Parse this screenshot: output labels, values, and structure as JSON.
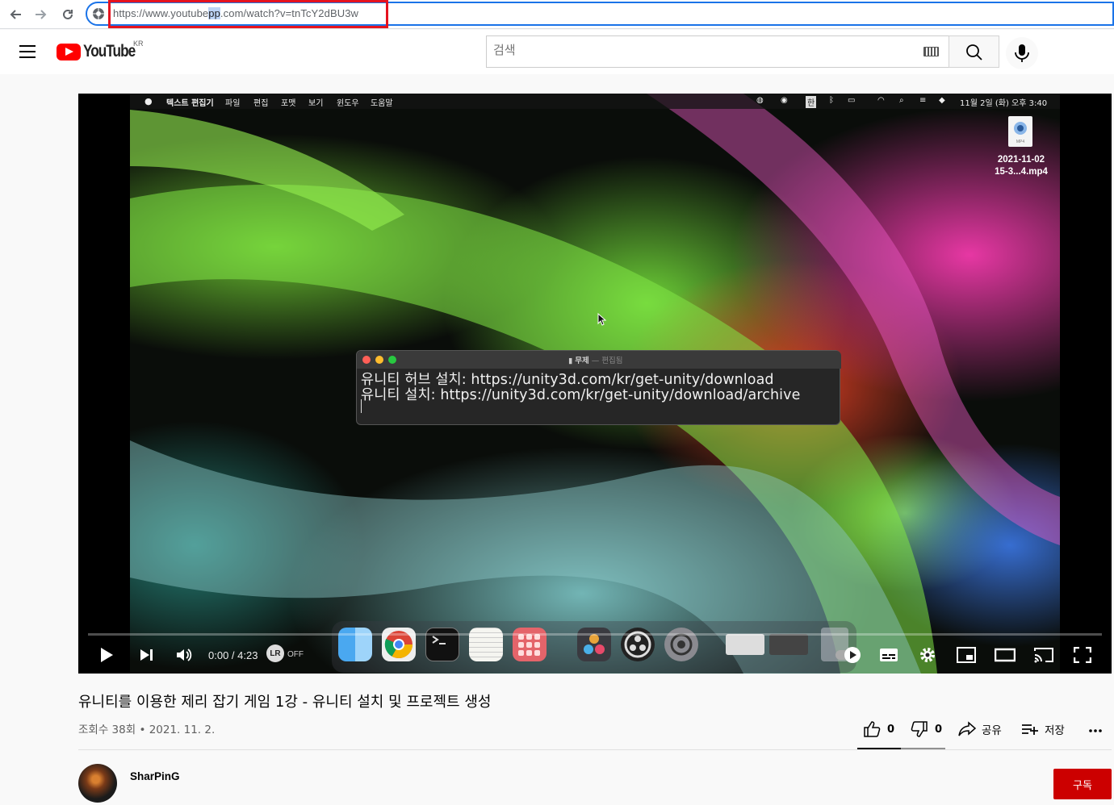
{
  "browser": {
    "url_prefix": "https://www.youtube",
    "url_highlight": "pp",
    "url_suffix": ".com/watch?v=tnTcY2dBU3w"
  },
  "header": {
    "logo_text": "YouTube",
    "region": "KR",
    "search_placeholder": "검색"
  },
  "video_frame": {
    "menubar": {
      "app": "텍스트 편집기",
      "items": [
        "파일",
        "편집",
        "포맷",
        "보기",
        "윈도우",
        "도움말"
      ],
      "ime": "한",
      "clock": "11월 2일 (화) 오후 3:40"
    },
    "desktop_file": {
      "badge": "MP4",
      "line1": "2021-11-02",
      "line2": "15-3...4.mp4"
    },
    "editor": {
      "title": "무제",
      "status": "— 편집됨",
      "lines": [
        "유니티 허브 설치: https://unity3d.com/kr/get-unity/download",
        "유니티 설치: https://unity3d.com/kr/get-unity/download/archive"
      ]
    }
  },
  "player": {
    "time": "0:00 / 4:23",
    "lr_badge": "LR",
    "lr_state": "OFF",
    "progress": 0
  },
  "video": {
    "title": "유니티를 이용한 제리 잡기 게임 1강 - 유니티 설치 및 프로젝트 생성",
    "meta": "조회수 38회 • 2021. 11. 2."
  },
  "actions": {
    "like_count": "0",
    "dislike_count": "0",
    "share_label": "공유",
    "save_label": "저장"
  },
  "channel": {
    "name": "SharPinG",
    "subscribe_label": "구독"
  },
  "colors": {
    "accent": "#1a73e8",
    "youtube_red": "#ff0000",
    "subscribe_red": "#cc0000",
    "annotation_red": "#e5131f"
  }
}
